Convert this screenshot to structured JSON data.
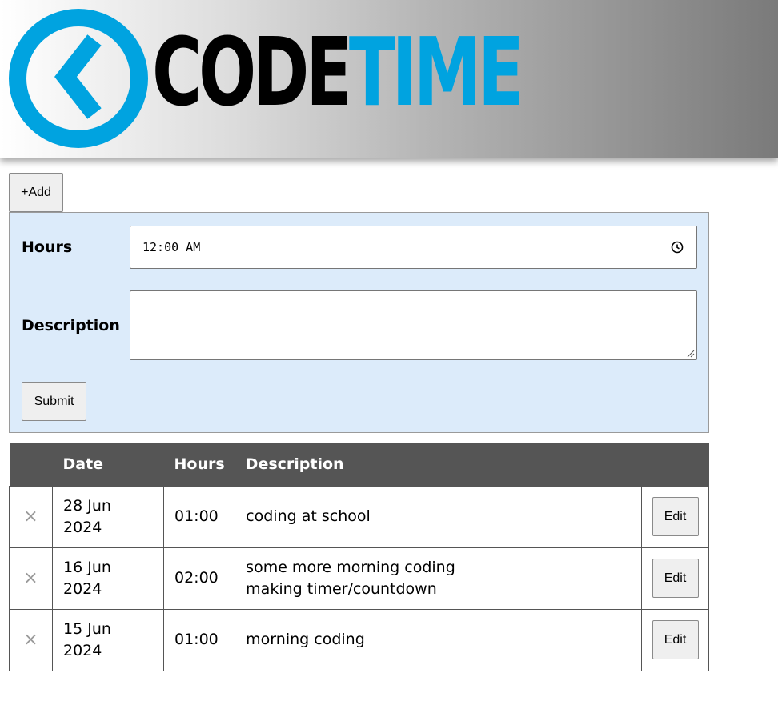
{
  "header": {
    "logo_code": "CODE",
    "logo_time": "TIME",
    "brand_colors": {
      "blue": "#00a3e0",
      "black": "#000000"
    },
    "logo_icon": "back-chevron-circle-icon"
  },
  "toolbar": {
    "add_label": "+Add"
  },
  "form": {
    "hours_label": "Hours",
    "hours_value": "12:00 AM",
    "description_label": "Description",
    "description_value": "",
    "submit_label": "Submit"
  },
  "table": {
    "headers": {
      "delete": "",
      "date": "Date",
      "hours": "Hours",
      "description": "Description",
      "edit": ""
    },
    "rows": [
      {
        "delete_icon": "×",
        "date": "28 Jun 2024",
        "hours": "01:00",
        "description": [
          "coding at school"
        ],
        "edit_label": "Edit"
      },
      {
        "delete_icon": "×",
        "date": "16 Jun 2024",
        "hours": "02:00",
        "description": [
          "some more morning coding",
          "making timer/countdown"
        ],
        "edit_label": "Edit"
      },
      {
        "delete_icon": "×",
        "date": "15 Jun 2024",
        "hours": "01:00",
        "description": [
          "morning coding"
        ],
        "edit_label": "Edit"
      }
    ]
  }
}
